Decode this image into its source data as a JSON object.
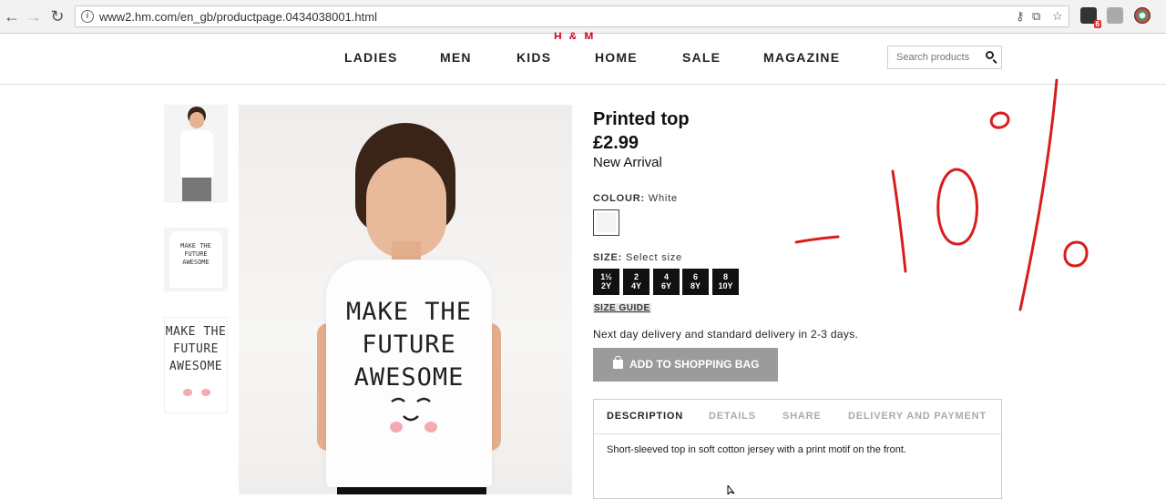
{
  "browser": {
    "url": "www2.hm.com/en_gb/productpage.0434038001.html",
    "back_icon": "←",
    "forward_icon": "→",
    "reload_icon": "↻",
    "info_icon": "i",
    "ext_badge": "6"
  },
  "nav": {
    "items": [
      "LADIES",
      "MEN",
      "KIDS",
      "HOME",
      "SALE",
      "MAGAZINE"
    ],
    "search_placeholder": "Search products"
  },
  "thumbnails": {
    "text_lines": [
      "MAKE THE",
      "FUTURE",
      "AWESOME"
    ]
  },
  "product": {
    "title": "Printed top",
    "price": "£2.99",
    "badge": "New Arrival",
    "colour_label": "COLOUR:",
    "colour_value": "White",
    "size_label": "SIZE:",
    "size_value": "Select size",
    "sizes": [
      {
        "top": "1½",
        "bottom": "2Y"
      },
      {
        "top": "2",
        "bottom": "4Y"
      },
      {
        "top": "4",
        "bottom": "6Y"
      },
      {
        "top": "6",
        "bottom": "8Y"
      },
      {
        "top": "8",
        "bottom": "10Y"
      }
    ],
    "size_guide": "SIZE GUIDE",
    "delivery": "Next day delivery and standard delivery in 2-3 days.",
    "add_to_bag": "ADD TO SHOPPING BAG",
    "shirt_print": [
      "MAKE THE",
      "FUTURE",
      "AWESOME"
    ]
  },
  "tabs": {
    "items": [
      "DESCRIPTION",
      "DETAILS",
      "SHARE",
      "DELIVERY AND PAYMENT"
    ],
    "active": "DESCRIPTION",
    "description": "Short-sleeved top in soft cotton jersey with a print motif on the front."
  },
  "annotation": {
    "text": "-10%",
    "color": "#d81d1d"
  },
  "colors": {
    "brand_red": "#cc071e",
    "button_gray": "#9b9b9b",
    "size_black": "#111111"
  }
}
